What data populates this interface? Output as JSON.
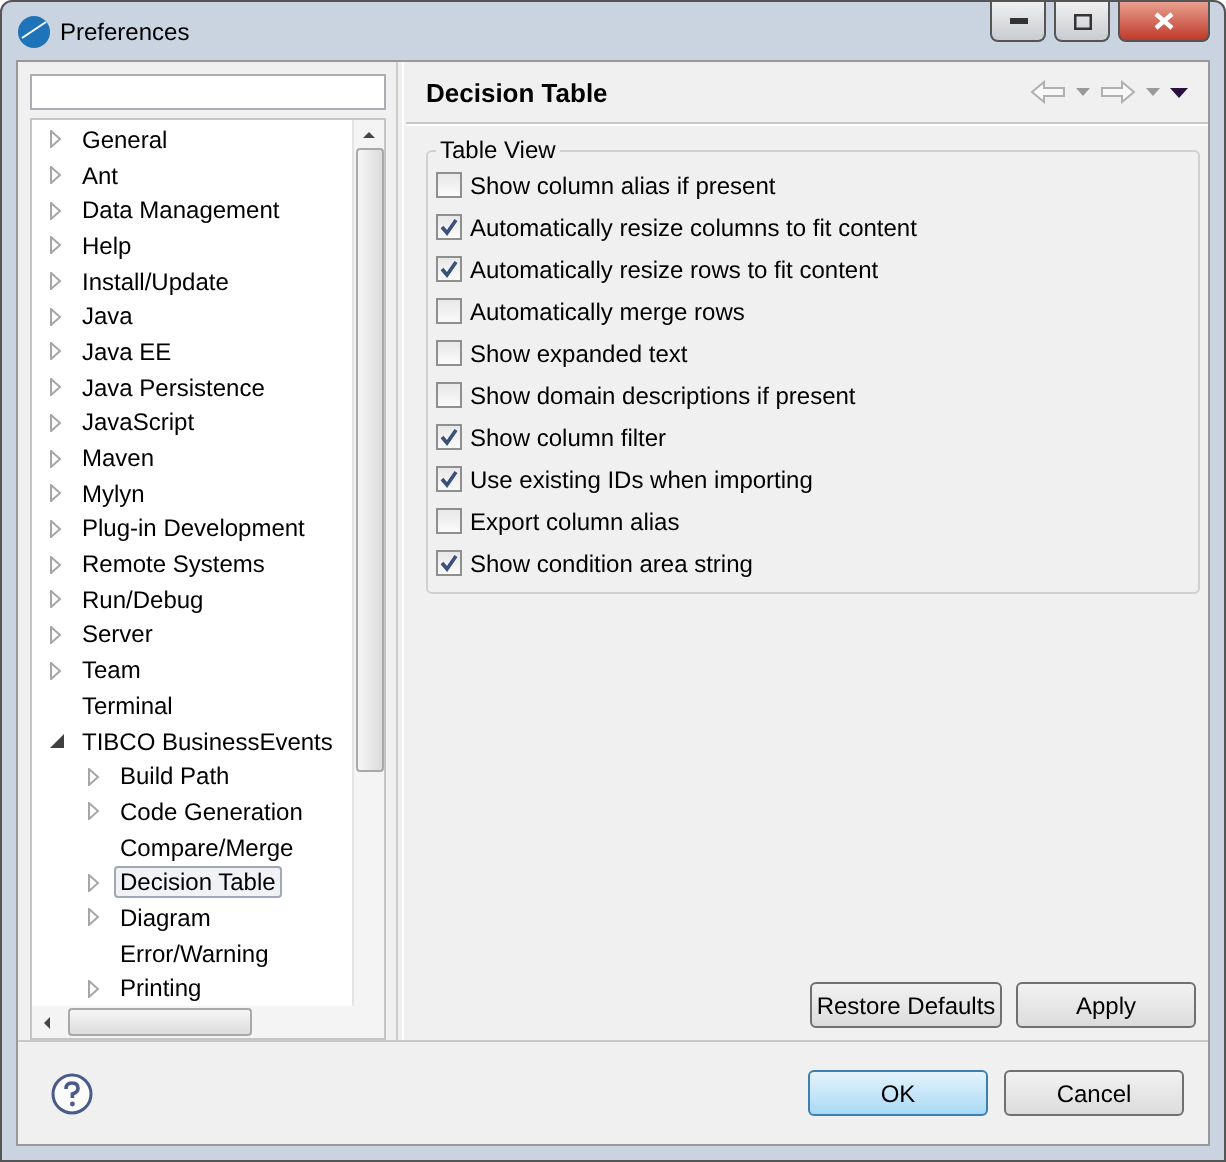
{
  "window": {
    "title": "Preferences"
  },
  "tree": [
    {
      "label": "General",
      "kind": "collapsed",
      "selected": false
    },
    {
      "label": "Ant",
      "kind": "collapsed",
      "selected": false
    },
    {
      "label": "Data Management",
      "kind": "collapsed",
      "selected": false
    },
    {
      "label": "Help",
      "kind": "collapsed",
      "selected": false
    },
    {
      "label": "Install/Update",
      "kind": "collapsed",
      "selected": false
    },
    {
      "label": "Java",
      "kind": "collapsed",
      "selected": false
    },
    {
      "label": "Java EE",
      "kind": "collapsed",
      "selected": false
    },
    {
      "label": "Java Persistence",
      "kind": "collapsed",
      "selected": false
    },
    {
      "label": "JavaScript",
      "kind": "collapsed",
      "selected": false
    },
    {
      "label": "Maven",
      "kind": "collapsed",
      "selected": false
    },
    {
      "label": "Mylyn",
      "kind": "collapsed",
      "selected": false
    },
    {
      "label": "Plug-in Development",
      "kind": "collapsed",
      "selected": false
    },
    {
      "label": "Remote Systems",
      "kind": "collapsed",
      "selected": false
    },
    {
      "label": "Run/Debug",
      "kind": "collapsed",
      "selected": false
    },
    {
      "label": "Server",
      "kind": "collapsed",
      "selected": false
    },
    {
      "label": "Team",
      "kind": "collapsed",
      "selected": false
    },
    {
      "label": "Terminal",
      "kind": "leaf",
      "selected": false
    },
    {
      "label": "TIBCO BusinessEvents",
      "kind": "expanded",
      "selected": false,
      "children": [
        {
          "label": "Build Path",
          "kind": "collapsed",
          "selected": false
        },
        {
          "label": "Code Generation",
          "kind": "collapsed",
          "selected": false
        },
        {
          "label": "Compare/Merge",
          "kind": "leaf",
          "selected": false
        },
        {
          "label": "Decision Table",
          "kind": "collapsed",
          "selected": true
        },
        {
          "label": "Diagram",
          "kind": "collapsed",
          "selected": false
        },
        {
          "label": "Error/Warning",
          "kind": "leaf",
          "selected": false
        },
        {
          "label": "Printing",
          "kind": "collapsed",
          "selected": false
        }
      ]
    }
  ],
  "page": {
    "title": "Decision Table",
    "group": "Table View",
    "options": [
      {
        "label": "Show column alias if present",
        "checked": false
      },
      {
        "label": "Automatically resize columns to fit content",
        "checked": true
      },
      {
        "label": "Automatically resize rows to fit content",
        "checked": true
      },
      {
        "label": "Automatically merge rows",
        "checked": false
      },
      {
        "label": "Show expanded text",
        "checked": false
      },
      {
        "label": "Show domain descriptions if present",
        "checked": false
      },
      {
        "label": "Show column filter",
        "checked": true
      },
      {
        "label": "Use existing IDs when importing",
        "checked": true
      },
      {
        "label": "Export column alias",
        "checked": false
      },
      {
        "label": "Show condition area string",
        "checked": true
      }
    ],
    "buttons": [
      "Restore Defaults",
      "Apply"
    ]
  },
  "dialog_buttons": [
    {
      "label": "OK",
      "default": true
    },
    {
      "label": "Cancel",
      "default": false
    }
  ]
}
